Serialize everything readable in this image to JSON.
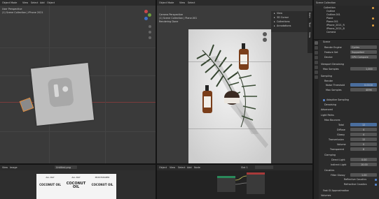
{
  "app": {
    "menu": [
      "Object Mode",
      "View",
      "Select",
      "Add",
      "Object"
    ],
    "editor_menu": [
      "View",
      "Image"
    ],
    "right_menu": [
      "Object",
      "Global"
    ]
  },
  "viewport3d": {
    "title": "User Perspective",
    "subtitle": "(1) Scene Collection | iPhone 2021"
  },
  "render_view": {
    "title": "Camera Perspective",
    "subtitle": "(1) Scene Collection | Plane.001",
    "status": "Rendering Done"
  },
  "n_panel_tabs": [
    "Item",
    "Tool",
    "View",
    "Create"
  ],
  "n_panel_items": [
    "View",
    "3D Cursor",
    "Collections",
    "Annotations"
  ],
  "image_editor": {
    "filename": "Untitled.png",
    "labels": [
      {
        "heading": "ALL DAY",
        "main": "COCONUT OIL"
      },
      {
        "heading": "ALL DAY",
        "main": "COCONUT OIL"
      },
      {
        "heading": "MOISTURIZER",
        "main": "COCONUT OIL"
      }
    ]
  },
  "node_editor": {
    "menu": [
      "Object",
      "View",
      "Select",
      "Add",
      "Node"
    ],
    "slot": "Slot 1"
  },
  "outliner": {
    "title": "Scene Collection",
    "items": [
      "Collection",
      "Outline",
      "Outline.001",
      "Plane",
      "Plane.001",
      "iPhone_2021_R",
      "iPhone_2021_B",
      "Camera"
    ]
  },
  "properties": {
    "scene": "Scene",
    "render_engine": {
      "label": "Render Engine",
      "value": "Cycles"
    },
    "feature_set": {
      "label": "Feature Set",
      "value": "Supported"
    },
    "device": {
      "label": "Device",
      "value": "GPU Compute"
    },
    "sections": {
      "sampling": "Sampling",
      "viewport_denoising": "Viewport Denoising",
      "render": "Render",
      "adaptive_sampling": "Adaptive Sampling",
      "denoising": "Denoising",
      "advanced": "Advanced",
      "light_paths": "Light Paths",
      "max_bounces": "Max Bounces",
      "clamping": "Clamping",
      "caustics": "Caustics",
      "fast_gi": "Fast GI Approximation",
      "volumes": "Volumes"
    },
    "viewport_samples": {
      "label": "Max Samples",
      "value": "1,000"
    },
    "noise_threshold": {
      "label": "Noise Threshold",
      "value": "0.0100"
    },
    "render_max_samples": {
      "label": "Max Samples",
      "value": "4096"
    },
    "bounces": [
      {
        "label": "Total",
        "value": "12"
      },
      {
        "label": "Diffuse",
        "value": "4"
      },
      {
        "label": "Glossy",
        "value": "4"
      },
      {
        "label": "Transmission",
        "value": "12"
      },
      {
        "label": "Volume",
        "value": "0"
      },
      {
        "label": "Transparent",
        "value": "8"
      }
    ],
    "clamp_direct": {
      "label": "Direct Light",
      "value": "0.00"
    },
    "clamp_indirect": {
      "label": "Indirect Light",
      "value": "10.00"
    },
    "filter_glossy": {
      "label": "Filter Glossy",
      "value": "1.00"
    },
    "reflective_caustics": "Reflective Caustics",
    "refractive_caustics": "Refractive Caustics",
    "colors": {
      "accent": "#4a6e9e",
      "checkbox": "#5680c2",
      "node_green": "#2a8a5a",
      "node_red": "#a83a3a"
    }
  }
}
